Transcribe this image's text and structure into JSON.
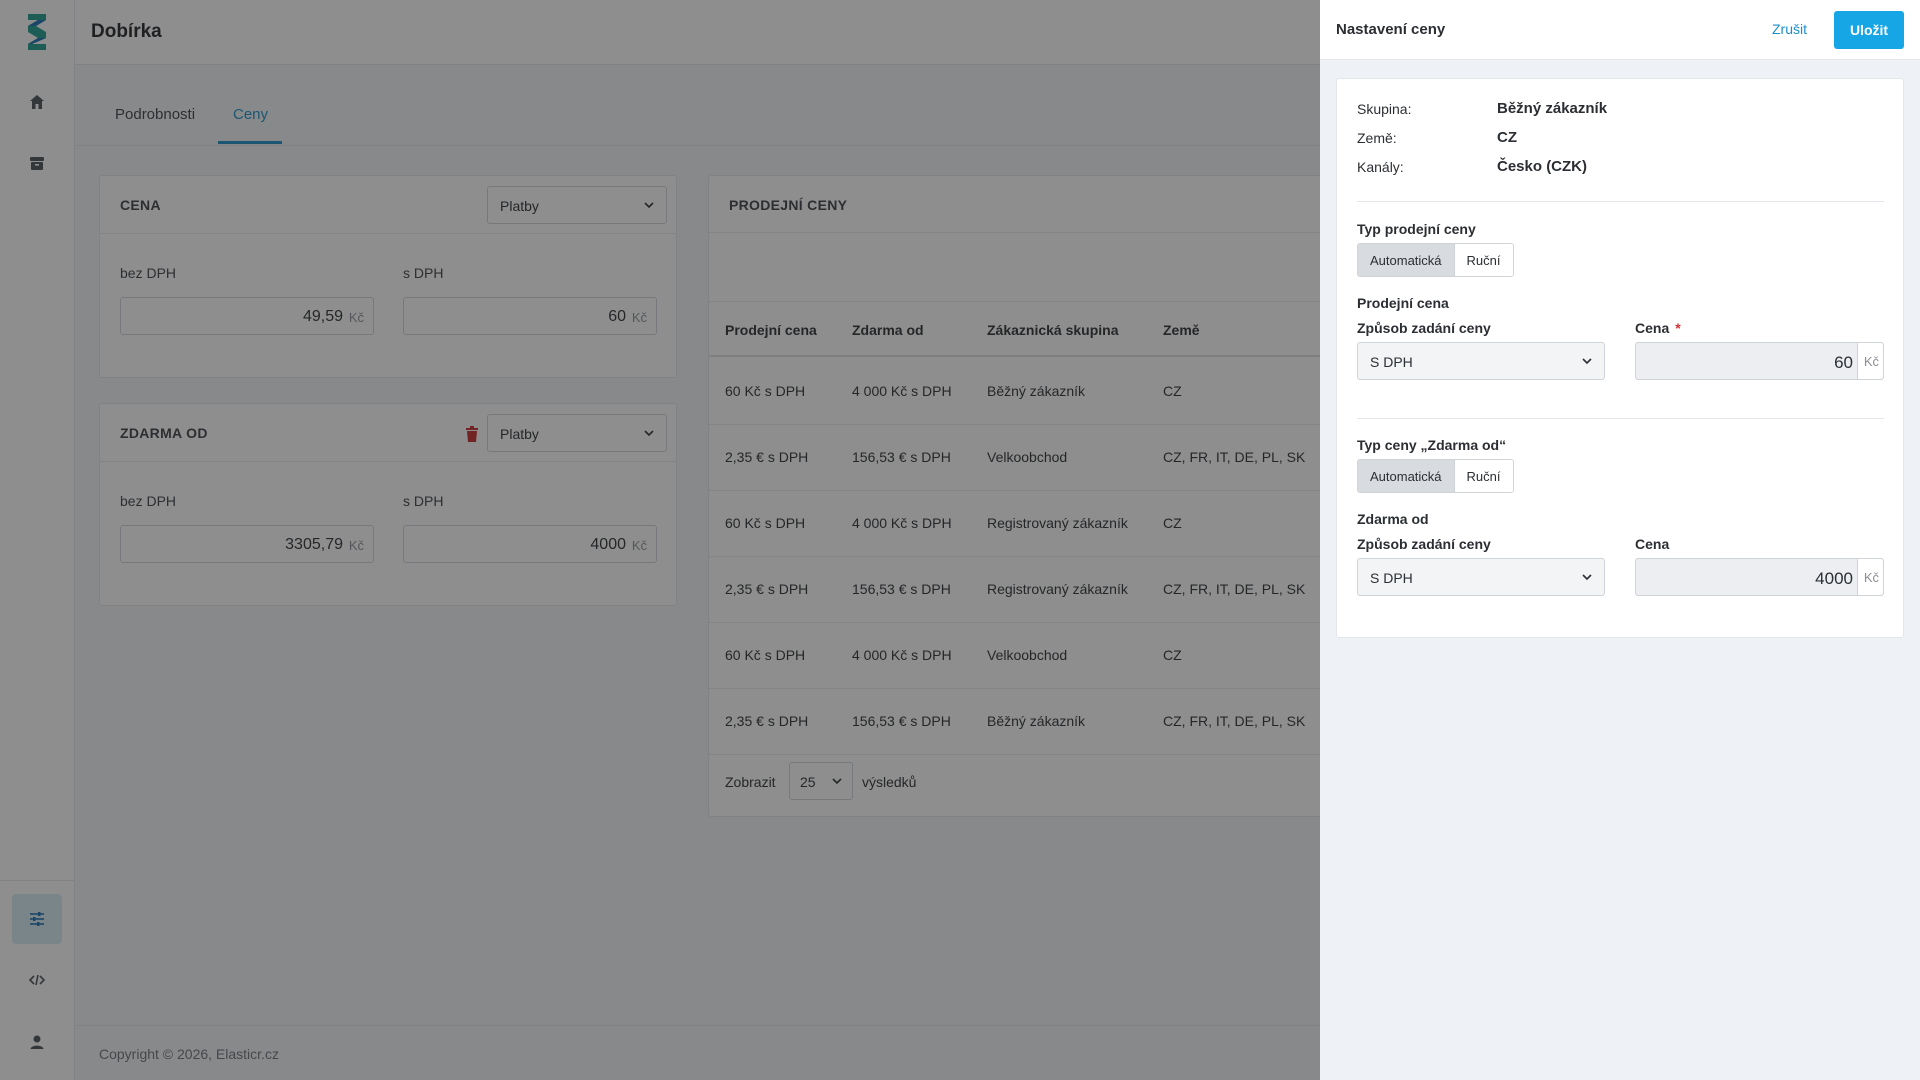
{
  "app": {
    "page_title": "Dobírka",
    "tabs": [
      {
        "label": "Podrobnosti",
        "active": false
      },
      {
        "label": "Ceny",
        "active": true
      }
    ],
    "footer": "Copyright © 2026, Elasticr.cz"
  },
  "price_card": {
    "title": "CENA",
    "select_value": "Platby",
    "without_vat_label": "bez DPH",
    "with_vat_label": "s DPH",
    "without_vat_value": "49,59",
    "with_vat_value": "60",
    "unit": "Kč"
  },
  "free_card": {
    "title": "ZDARMA OD",
    "select_value": "Platby",
    "without_vat_label": "bez DPH",
    "with_vat_label": "s DPH",
    "without_vat_value": "3305,79",
    "with_vat_value": "4000",
    "unit": "Kč"
  },
  "sales_card": {
    "title": "PRODEJNÍ CENY",
    "columns": [
      "Prodejní cena",
      "Zdarma od",
      "Zákaznická skupina",
      "Země"
    ],
    "rows": [
      [
        "60 Kč s DPH",
        "4 000 Kč s DPH",
        "Běžný zákazník",
        "CZ"
      ],
      [
        "2,35 € s DPH",
        "156,53 € s DPH",
        "Velkoobchod",
        "CZ, FR, IT, DE, PL, SK"
      ],
      [
        "60 Kč s DPH",
        "4 000 Kč s DPH",
        "Registrovaný zákazník",
        "CZ"
      ],
      [
        "2,35 € s DPH",
        "156,53 € s DPH",
        "Registrovaný zákazník",
        "CZ, FR, IT, DE, PL, SK"
      ],
      [
        "60 Kč s DPH",
        "4 000 Kč s DPH",
        "Velkoobchod",
        "CZ"
      ],
      [
        "2,35 € s DPH",
        "156,53 € s DPH",
        "Běžný zákazník",
        "CZ, FR, IT, DE, PL, SK"
      ]
    ],
    "paging": {
      "show_label": "Zobrazit",
      "per_page": "25",
      "results_label": "výsledků"
    }
  },
  "drawer": {
    "title": "Nastavení ceny",
    "cancel_label": "Zrušit",
    "save_label": "Uložit",
    "info": [
      {
        "key": "Skupina:",
        "value": "Běžný zákazník"
      },
      {
        "key": "Země:",
        "value": "CZ"
      },
      {
        "key": "Kanály:",
        "value": "Česko (CZK)"
      }
    ],
    "sale_price_type_label": "Typ prodejní ceny",
    "seg_auto": "Automatická",
    "seg_manual": "Ruční",
    "sale_price_label": "Prodejní cena",
    "entry_method_label": "Způsob zadání ceny",
    "price_label": "Cena",
    "required_mark": "*",
    "sale_entry_value": "S DPH",
    "sale_price_value": "60",
    "free_type_label": "Typ ceny „Zdarma od“",
    "free_label": "Zdarma od",
    "free_entry_value": "S DPH",
    "free_price_value": "4000",
    "unit": "Kč"
  },
  "colors": {
    "accent": "#1b8fc8",
    "save_button": "#16a6e6",
    "danger": "#c62828",
    "logo_teal": "#1f9d8f",
    "logo_blue": "#1b6fb0"
  }
}
